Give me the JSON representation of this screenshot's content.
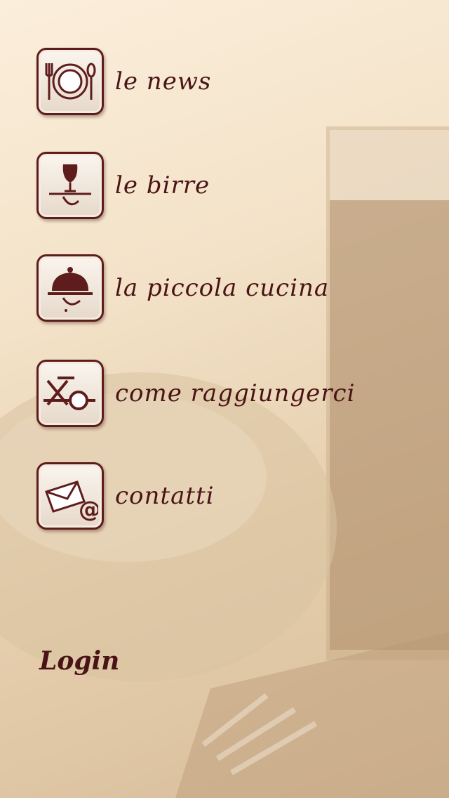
{
  "menu": {
    "items": [
      {
        "label": "le news",
        "icon": "plate-cutlery-icon"
      },
      {
        "label": "le birre",
        "icon": "beer-tray-icon"
      },
      {
        "label": "la piccola cucina",
        "icon": "cloche-icon"
      },
      {
        "label": "come raggiungerci",
        "icon": "route-map-icon"
      },
      {
        "label": "contatti",
        "icon": "mail-at-icon"
      }
    ]
  },
  "login": {
    "label": "Login"
  },
  "colors": {
    "accent": "#4a1416",
    "border": "#5e1d1c",
    "background": "#f3e2c8"
  }
}
